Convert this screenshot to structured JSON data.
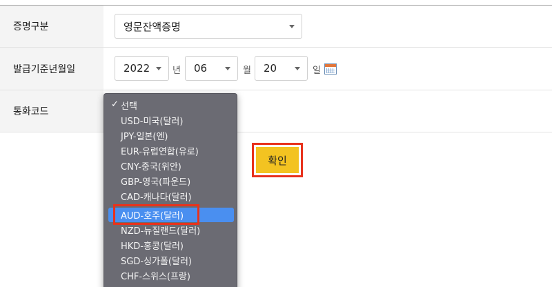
{
  "form": {
    "cert_type": {
      "label": "증명구분",
      "value": "영문잔액증명"
    },
    "issue_date": {
      "label": "발급기준년월일",
      "year": "2022",
      "year_unit": "년",
      "month": "06",
      "month_unit": "월",
      "day": "20",
      "day_unit": "일"
    },
    "currency": {
      "label": "통화코드"
    }
  },
  "confirm_label": "확인",
  "currency_options": [
    {
      "label": "선택",
      "checked": true
    },
    {
      "label": "USD-미국(달러)"
    },
    {
      "label": "JPY-일본(엔)"
    },
    {
      "label": "EUR-유럽연합(유로)"
    },
    {
      "label": "CNY-중국(위안)"
    },
    {
      "label": "GBP-영국(파운드)"
    },
    {
      "label": "CAD-캐나다(달러)"
    },
    {
      "label": "AUD-호주(달러)",
      "highlighted": true
    },
    {
      "label": "NZD-뉴질랜드(달러)"
    },
    {
      "label": "HKD-홍콩(달러)"
    },
    {
      "label": "SGD-싱가폴(달러)"
    },
    {
      "label": "CHF-스위스(프랑)"
    }
  ],
  "colors": {
    "confirm_bg": "#f3c321",
    "highlight_border": "#e8321c",
    "option_highlight": "#4a8ff0",
    "dropdown_bg": "#6b6b73"
  }
}
